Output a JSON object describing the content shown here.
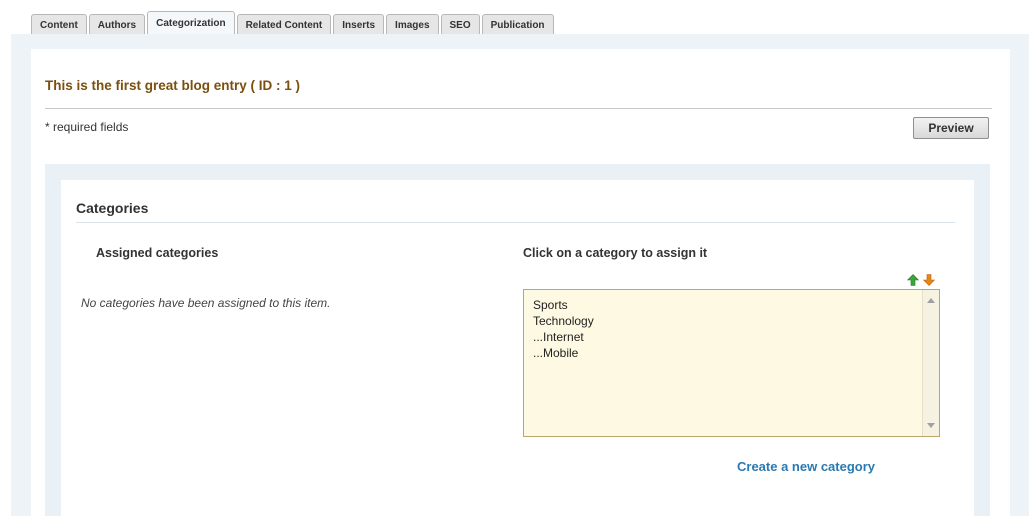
{
  "tabs": [
    {
      "label": "Content"
    },
    {
      "label": "Authors"
    },
    {
      "label": "Categorization",
      "active": true
    },
    {
      "label": "Related Content"
    },
    {
      "label": "Inserts"
    },
    {
      "label": "Images"
    },
    {
      "label": "SEO"
    },
    {
      "label": "Publication"
    }
  ],
  "entry": {
    "title": "This is the first great blog entry ( ID : 1 )",
    "required_note": "* required fields",
    "preview_label": "Preview"
  },
  "categories": {
    "heading": "Categories",
    "assigned_heading": "Assigned categories",
    "none_assigned": "No categories have been assigned to this item.",
    "available_heading": "Click on a category to assign it",
    "available": [
      "Sports",
      "Technology",
      "...Internet",
      "...Mobile"
    ],
    "create_link": "Create a new category"
  },
  "icons": {
    "move_up": "green-up-arrow-icon",
    "move_down": "orange-down-arrow-icon"
  },
  "colors": {
    "title": "#7a4f0f",
    "link": "#2a7ab0",
    "listbox_bg": "#fdf9e2",
    "arrow_up": "#3aa53a",
    "arrow_down": "#e8841a"
  }
}
